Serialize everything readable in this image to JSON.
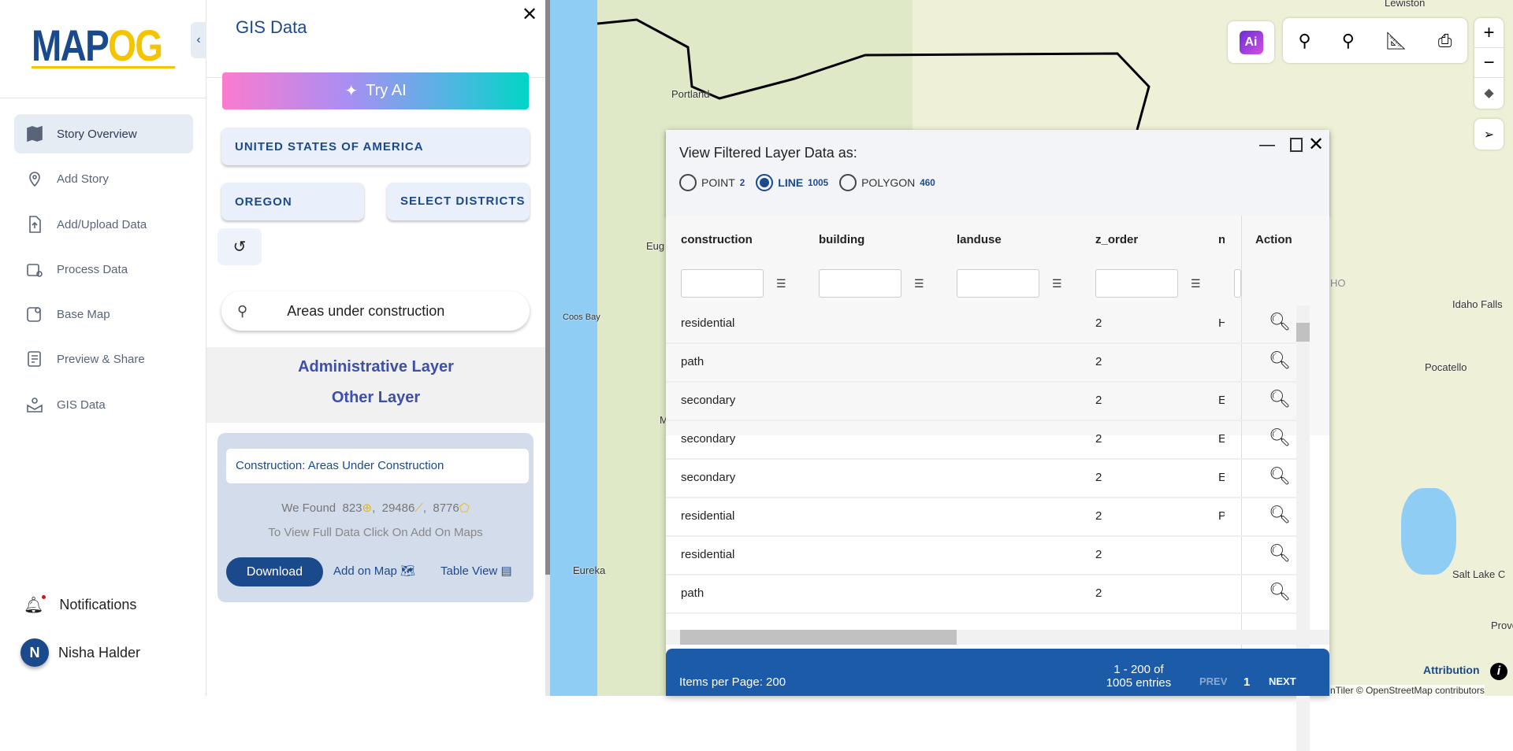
{
  "logo": {
    "text_a": "MAP",
    "text_b": "OG"
  },
  "sidebar": {
    "items": [
      {
        "label": "Story Overview",
        "icon": "map-icon",
        "active": true
      },
      {
        "label": "Add Story",
        "icon": "location-pin-icon"
      },
      {
        "label": "Add/Upload Data",
        "icon": "upload-file-icon"
      },
      {
        "label": "Process Data",
        "icon": "process-data-icon"
      },
      {
        "label": "Base Map",
        "icon": "base-map-icon"
      },
      {
        "label": "Preview & Share",
        "icon": "preview-share-icon"
      },
      {
        "label": "GIS Data",
        "icon": "gis-data-icon"
      }
    ],
    "notifications": "Notifications",
    "user_initial": "N",
    "user_name": "Nisha Halder"
  },
  "panel": {
    "title": "GIS Data",
    "try_ai": "Try AI",
    "country": "UNITED STATES OF AMERICA",
    "state": "OREGON",
    "districts": "SELECT DISTRICTS",
    "search_value": "Areas under construction",
    "admin_layer": "Administrative Layer",
    "other_layer": "Other Layer",
    "card": {
      "title": "Construction: Areas Under Construction",
      "found_prefix": "We Found",
      "point_count": "823",
      "line_count": "29486",
      "polygon_count": "8776",
      "hint": "To View Full Data Click On Add On Maps",
      "download": "Download",
      "add_on_map": "Add on Map",
      "table_view": "Table View"
    }
  },
  "map": {
    "labels": [
      "Lewiston",
      "Portland",
      "Eug",
      "Coos Bay",
      "Idaho Falls",
      "Pocatello",
      "Eureka",
      "Salt Lake C",
      "Provo",
      "HO",
      "M"
    ],
    "attribution": "Attribution",
    "credits": "nTiler © OpenStreetMap contributors"
  },
  "popup": {
    "title": "View Filtered Layer Data as:",
    "options": [
      {
        "label": "POINT",
        "count": "2"
      },
      {
        "label": "LINE",
        "count": "1005",
        "selected": true
      },
      {
        "label": "POLYGON",
        "count": "460"
      }
    ],
    "columns": [
      "construction",
      "building",
      "landuse",
      "z_order",
      "n",
      "Action"
    ],
    "rows": [
      [
        "residential",
        "",
        "",
        "2",
        "H"
      ],
      [
        "path",
        "",
        "",
        "2",
        ""
      ],
      [
        "secondary",
        "",
        "",
        "2",
        "E"
      ],
      [
        "secondary",
        "",
        "",
        "2",
        "E"
      ],
      [
        "secondary",
        "",
        "",
        "2",
        "E"
      ],
      [
        "residential",
        "",
        "",
        "2",
        "P"
      ],
      [
        "residential",
        "",
        "",
        "2",
        ""
      ],
      [
        "path",
        "",
        "",
        "2",
        ""
      ]
    ],
    "footer": {
      "items_per_page": "Items per Page: 200",
      "range": "1 - 200 of",
      "total": "1005 entries",
      "prev": "PREV",
      "page": "1",
      "next": "NEXT"
    }
  },
  "colors": {
    "brand": "#1b4a8c",
    "accent": "#f5c400",
    "footer": "#1c5ba8",
    "selected": "#1b4a8c"
  }
}
